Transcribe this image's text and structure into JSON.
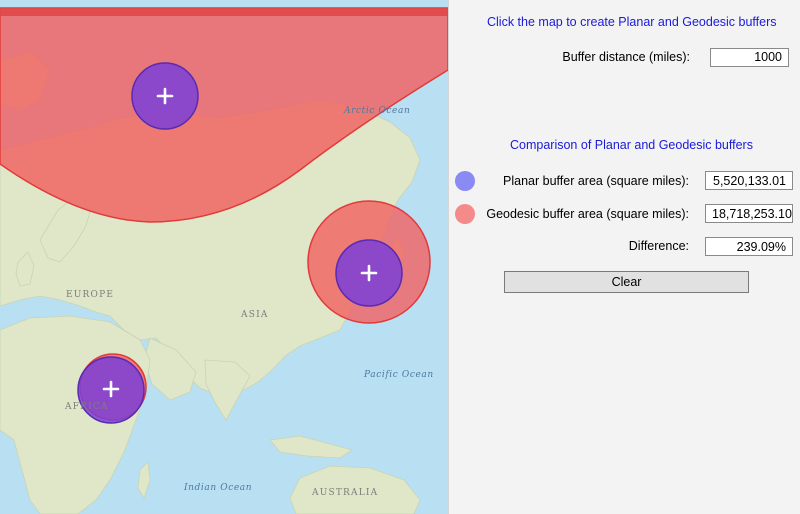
{
  "panel": {
    "instructions": "Click the map to create Planar and Geodesic buffers",
    "buffer_distance_label": "Buffer distance (miles):",
    "buffer_distance_value": "1000",
    "comparison_title": "Comparison of Planar and Geodesic buffers",
    "planar_label": "Planar buffer area (square miles):",
    "planar_value": "5,520,133.01",
    "geodesic_label": "Geodesic buffer area (square miles):",
    "geodesic_value": "18,718,253.10",
    "difference_label": "Difference:",
    "difference_value": "239.09%",
    "clear_label": "Clear"
  },
  "legend": {
    "planar_color": "#8a8af4",
    "geodesic_color": "#f48a8a"
  },
  "map": {
    "labels": {
      "arctic": "Arctic Ocean",
      "europe": "EUROPE",
      "asia": "ASIA",
      "pacific": "Pacific Ocean",
      "africa": "AFRICA",
      "indian": "Indian Ocean",
      "australia": "AUSTRALIA"
    },
    "colors": {
      "water": "#b9dff2",
      "land": "#dfe7c8",
      "planar_fill": "#7b3fd8",
      "geodesic_fill": "#f26060",
      "marker": "#ffffff"
    },
    "marker_icon": "plus-icon"
  }
}
